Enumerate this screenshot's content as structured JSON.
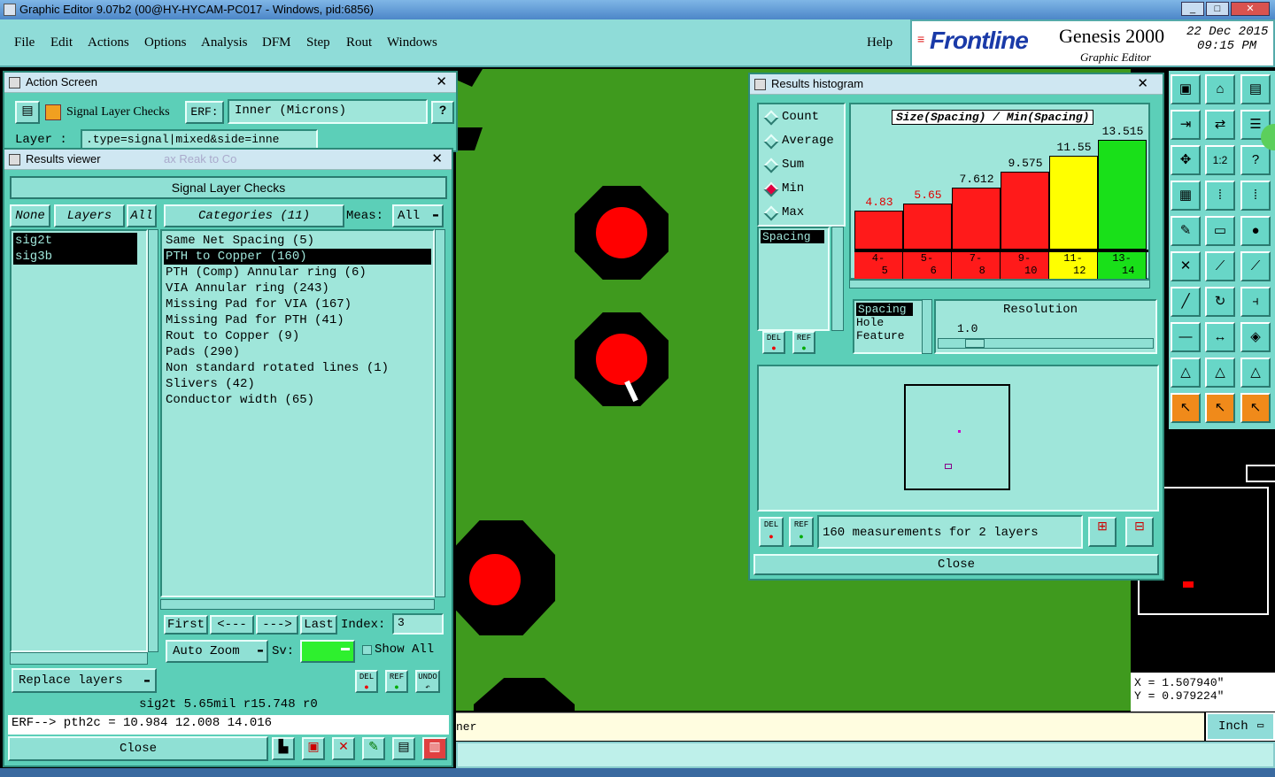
{
  "window": {
    "title": "Graphic Editor 9.07b2 (00@HY-HYCAM-PC017 - Windows, pid:6856)"
  },
  "menu": {
    "items": [
      "File",
      "Edit",
      "Actions",
      "Options",
      "Analysis",
      "DFM",
      "Step",
      "Rout",
      "Windows"
    ],
    "help": "Help"
  },
  "brand": {
    "logo": "Frontline",
    "product": "Genesis 2000",
    "sub": "Graphic Editor",
    "date": "22 Dec 2015",
    "time": "09:15 PM"
  },
  "action_screen": {
    "title": "Action Screen",
    "check_name": "Signal Layer Checks",
    "erf_label": "ERF:",
    "erf_value": "Inner (Microns)",
    "layer_label": "Layer :",
    "layer_value": ".type=signal|mixed&side=inne",
    "help": "?"
  },
  "results_viewer": {
    "title": "Results viewer",
    "faded_bg": "ax Reak to Co",
    "header": "Signal Layer Checks",
    "none_btn": "None",
    "layers_btn": "Layers",
    "all_btn": "All",
    "categories_label": "Categories (11)",
    "meas_label": "Meas:",
    "meas_value": "All",
    "layers": [
      "sig2t",
      "sig3b"
    ],
    "categories": [
      "Same Net Spacing (5)",
      "PTH to Copper (160)",
      "PTH (Comp) Annular ring (6)",
      "VIA Annular ring (243)",
      "Missing Pad for VIA (167)",
      "Missing Pad for PTH (41)",
      "Rout to Copper (9)",
      "Pads (290)",
      "Non standard rotated lines (1)",
      "Slivers (42)",
      "Conductor width (65)"
    ],
    "selected_category": 1,
    "nav": {
      "first": "First",
      "prev": "<---",
      "next": "--->",
      "last": "Last",
      "index_label": "Index:",
      "index_value": "3"
    },
    "auto_zoom": "Auto Zoom",
    "sv_label": "Sv:",
    "show_all": "Show All",
    "replace_layers": "Replace layers",
    "del": "DEL",
    "ref": "REF",
    "undo": "UNDO",
    "status": "sig2t 5.65mil  r15.748  r0",
    "erf_line": "ERF--> pth2c = 10.984 12.008 14.016",
    "close": "Close",
    "green_color": "#2ef02e"
  },
  "histogram": {
    "title": "Results histogram",
    "options": [
      "Count",
      "Average",
      "Sum",
      "Min",
      "Max"
    ],
    "selected_option": 3,
    "type_list": [
      "Spacing"
    ],
    "chart_title": "Size(Spacing) / Min(Spacing)",
    "del": "DEL",
    "ref": "REF",
    "resolution_list": [
      "Spacing",
      "Hole",
      "Feature"
    ],
    "resolution_label": "Resolution",
    "resolution_value": "1.0",
    "summary": "160 measurements for 2 layers",
    "close": "Close"
  },
  "chart_data": {
    "type": "bar",
    "title": "Size(Spacing) / Min(Spacing)",
    "categories": [
      "4-5",
      "5-6",
      "7-8",
      "9-10",
      "11-12",
      "13-14"
    ],
    "values": [
      4.83,
      5.65,
      7.612,
      9.575,
      11.55,
      13.515
    ],
    "value_labels": [
      "4.83",
      "5.65",
      "7.612",
      "9.575",
      "11.55",
      "13.515"
    ],
    "colors": [
      "#ff1a1a",
      "#ff1a1a",
      "#ff1a1a",
      "#ff1a1a",
      "#ffff00",
      "#19e019"
    ],
    "label_colors": [
      "#e00000",
      "#e00000",
      "#000000",
      "#000000",
      "#000000",
      "#000000"
    ],
    "ylim": [
      0,
      14
    ]
  },
  "status": {
    "text": "ner"
  },
  "unit": "Inch",
  "coords": {
    "x": "X = 1.507940\"",
    "y": "Y = 0.979224\""
  },
  "colors": {
    "canvas": "#3f9a1e",
    "panel": "#5ccfb8",
    "pad": "#ff0000"
  }
}
